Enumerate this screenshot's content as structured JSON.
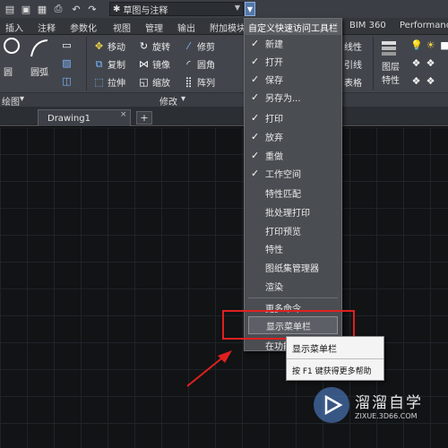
{
  "quick_access": {
    "workspace": "草图与注释",
    "icons": [
      "new-icon",
      "save-icon",
      "undo-icon",
      "redo-icon"
    ]
  },
  "ribbon_tabs": [
    "插入",
    "注释",
    "参数化",
    "视图",
    "管理",
    "输出",
    "附加模块",
    "BIM 360",
    "Performance"
  ],
  "ribbon": {
    "draw_panel": {
      "title": "绘图",
      "circle": "圆",
      "arc": "圆弧"
    },
    "modify_panel": {
      "title": "修改",
      "move": "移动",
      "rotate": "旋转",
      "trim": "修剪",
      "copy": "复制",
      "mirror": "镜像",
      "fillet": "圆角",
      "stretch": "拉伸",
      "scale": "缩放",
      "array": "阵列"
    },
    "right": {
      "linetype": "线性",
      "leader": "引线",
      "table": "表格",
      "layer_props": "图层\n特性"
    }
  },
  "document": {
    "tab_label": "Drawing1",
    "close_glyph": "×",
    "new_tab": "+"
  },
  "qat_menu": {
    "header": "自定义快速访问工具栏",
    "items": [
      {
        "label": "新建",
        "checked": true
      },
      {
        "label": "打开",
        "checked": true
      },
      {
        "label": "保存",
        "checked": true
      },
      {
        "label": "另存为...",
        "checked": true
      },
      {
        "label": "打印",
        "checked": true
      },
      {
        "label": "放弃",
        "checked": true
      },
      {
        "label": "重做",
        "checked": true
      },
      {
        "label": "工作空间",
        "checked": true
      },
      {
        "label": "特性匹配",
        "checked": false
      },
      {
        "label": "批处理打印",
        "checked": false
      },
      {
        "label": "打印预览",
        "checked": false
      },
      {
        "label": "特性",
        "checked": false
      },
      {
        "label": "图纸集管理器",
        "checked": false
      },
      {
        "label": "渲染",
        "checked": false
      }
    ],
    "more_commands": "更多命令...",
    "show_menubar": "显示菜单栏",
    "below_ribbon": "在功能"
  },
  "tooltip": {
    "title": "显示菜单栏",
    "help": "按 F1 键获得更多帮助"
  },
  "watermark": {
    "title": "溜溜自学",
    "url": "ZIXUE.3D66.COM"
  },
  "colors": {
    "highlight": "#e02020",
    "arrow": "#e02020",
    "menu_bg": "#4a4d52"
  }
}
